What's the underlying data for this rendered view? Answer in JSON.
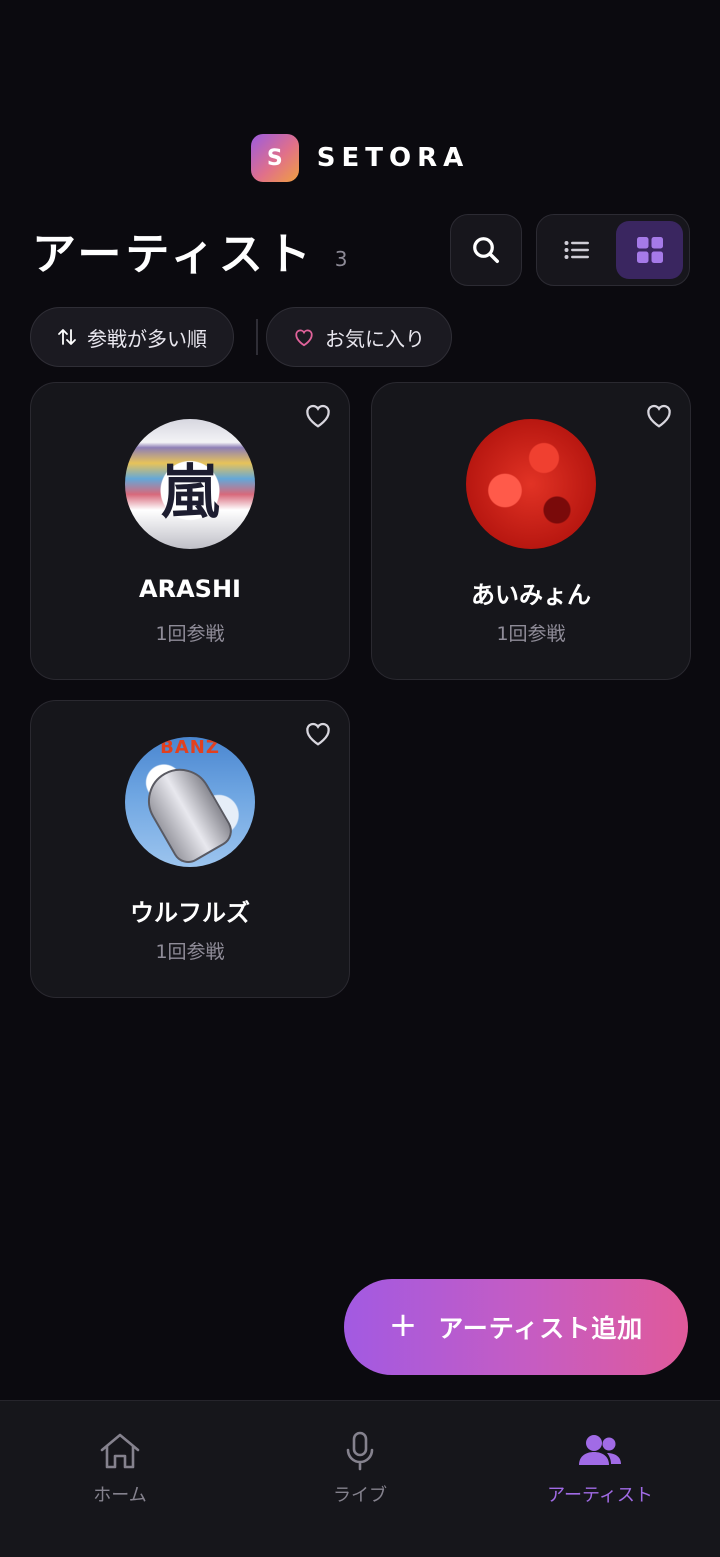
{
  "brand": {
    "logo_letter": "S",
    "name": "SETORA"
  },
  "header": {
    "title": "アーティスト",
    "count": "3"
  },
  "filters": {
    "sort_label": "参戦が多い順",
    "favorites_label": "お気に入り"
  },
  "artists": [
    {
      "name": "ARASHI",
      "attendance": "1回参戦",
      "avatar_text": "嵐"
    },
    {
      "name": "あいみょん",
      "attendance": "1回参戦"
    },
    {
      "name": "ウルフルズ",
      "attendance": "1回参戦",
      "avatar_text": "BANZ"
    }
  ],
  "fab": {
    "plus": "+",
    "label": "アーティスト追加"
  },
  "nav": {
    "items": [
      {
        "label": "ホーム",
        "icon": "home-icon"
      },
      {
        "label": "ライブ",
        "icon": "microphone-icon"
      },
      {
        "label": "アーティスト",
        "icon": "users-icon"
      }
    ],
    "active_index": 2
  },
  "colors": {
    "background": "#0b0a0f",
    "accent": "#a16be6",
    "favorite_pink": "#e0629a"
  }
}
